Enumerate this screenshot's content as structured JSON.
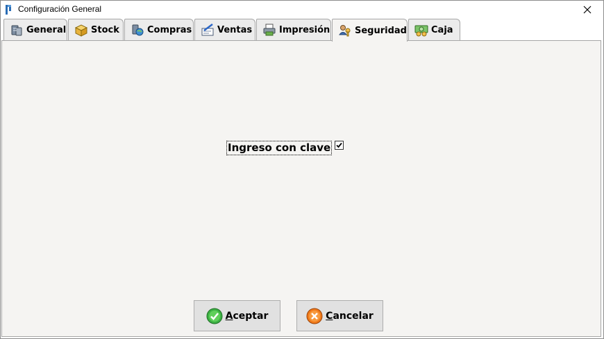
{
  "window": {
    "title": "Configuración General"
  },
  "tabs": [
    {
      "label": "General",
      "icon": "database-server-icon",
      "active": false
    },
    {
      "label": "Stock",
      "icon": "box-icon",
      "active": false
    },
    {
      "label": "Compras",
      "icon": "database-globe-icon",
      "active": false
    },
    {
      "label": "Ventas",
      "icon": "pen-form-icon",
      "active": false
    },
    {
      "label": "Impresión",
      "icon": "printer-icon",
      "active": false
    },
    {
      "label": "Seguridad",
      "icon": "users-key-icon",
      "active": true
    },
    {
      "label": "Caja",
      "icon": "cash-icon",
      "active": false
    }
  ],
  "security": {
    "login_with_password_label": "Ingreso con clave",
    "login_with_password_checked": true
  },
  "buttons": {
    "accept": {
      "first": "A",
      "rest": "ceptar"
    },
    "cancel": {
      "first": "C",
      "rest": "ancelar"
    }
  },
  "colors": {
    "accept_icon": "#3cb043",
    "cancel_icon": "#f07a1a",
    "active_tab": "#f5f4f2"
  }
}
